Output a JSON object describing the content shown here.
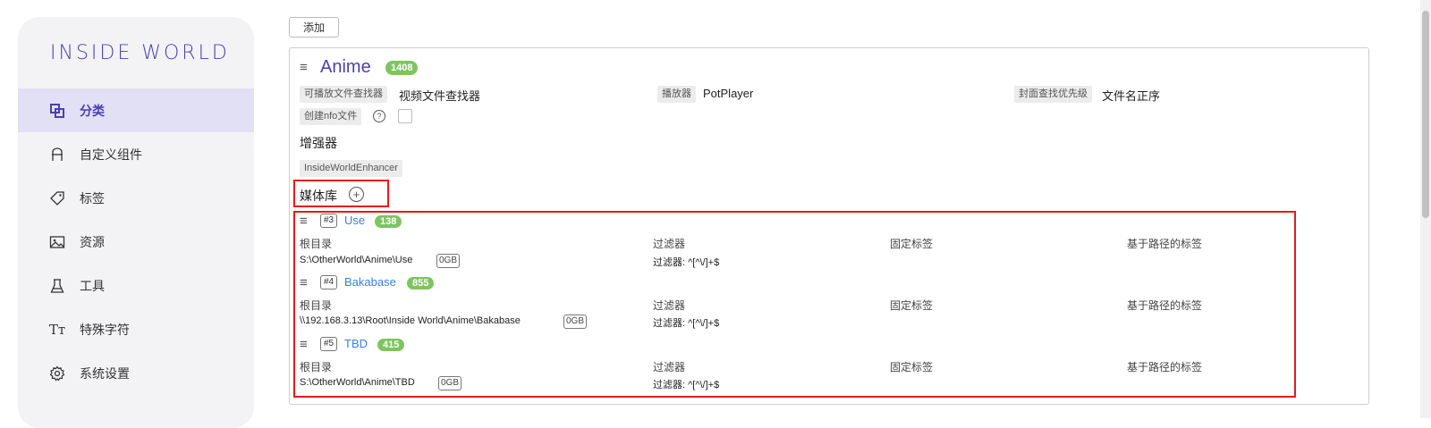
{
  "sidebar": {
    "logo": "INSIDE WORLD",
    "items": [
      {
        "label": "分类",
        "icon": "category-icon",
        "active": true
      },
      {
        "label": "自定义组件",
        "icon": "component-icon",
        "active": false
      },
      {
        "label": "标签",
        "icon": "tag-icon",
        "active": false
      },
      {
        "label": "资源",
        "icon": "image-icon",
        "active": false
      },
      {
        "label": "工具",
        "icon": "flask-icon",
        "active": false
      },
      {
        "label": "特殊字符",
        "icon": "text-size-icon",
        "active": false
      },
      {
        "label": "系统设置",
        "icon": "gear-icon",
        "active": false
      }
    ]
  },
  "toolbar": {
    "add_label": "添加"
  },
  "category": {
    "menu_icon": "≡",
    "name": "Anime",
    "count": "1408",
    "props": {
      "finder_label": "可播放文件查找器",
      "finder_value": "视频文件查找器",
      "player_label": "播放器",
      "player_value": "PotPlayer",
      "cover_label": "封面查找优先级",
      "cover_value": "文件名正序",
      "nfo_label": "创建nfo文件",
      "nfo_help": "?"
    },
    "enhancer_title": "增强器",
    "enhancer_tag": "InsideWorldEnhancer",
    "library_title": "媒体库",
    "library_add": "+",
    "libraries": [
      {
        "id": "#3",
        "name": "Use",
        "count": "138",
        "root_label": "根目录",
        "root_value": "S:\\OtherWorld\\Anime\\Use",
        "size": "0GB",
        "filter_label": "过滤器",
        "filter_value": "过滤器: ^[^\\/]+$",
        "fixed_label": "固定标签",
        "path_tag_label": "基于路径的标签"
      },
      {
        "id": "#4",
        "name": "Bakabase",
        "count": "855",
        "root_label": "根目录",
        "root_value": "\\\\192.168.3.13\\Root\\Inside World\\Anime\\Bakabase",
        "size": "0GB",
        "filter_label": "过滤器",
        "filter_value": "过滤器: ^[^\\/]+$",
        "fixed_label": "固定标签",
        "path_tag_label": "基于路径的标签"
      },
      {
        "id": "#5",
        "name": "TBD",
        "count": "415",
        "root_label": "根目录",
        "root_value": "S:\\OtherWorld\\Anime\\TBD",
        "size": "0GB",
        "filter_label": "过滤器",
        "filter_value": "过滤器: ^[^\\/]+$",
        "fixed_label": "固定标签",
        "path_tag_label": "基于路径的标签"
      }
    ]
  },
  "colors": {
    "accent": "#4b3fb0",
    "highlight": "#e21b1b",
    "count_badge": "#7dc560",
    "link": "#3c7fd6"
  }
}
